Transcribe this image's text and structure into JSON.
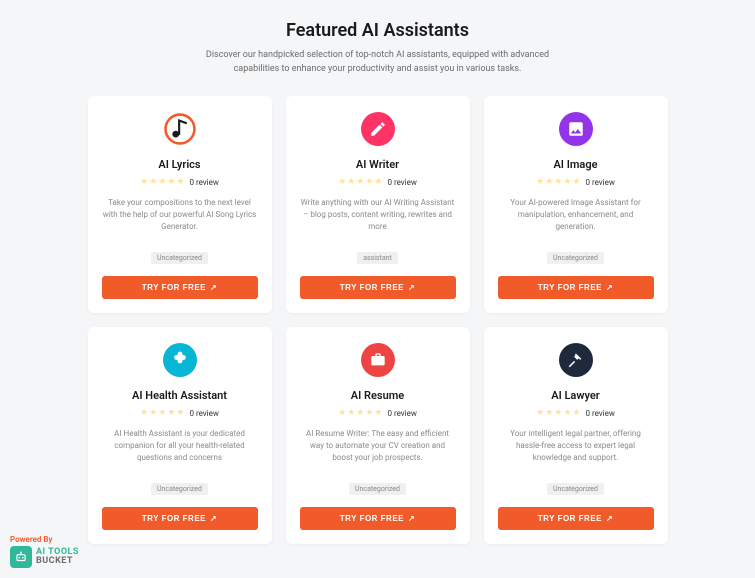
{
  "header": {
    "title": "Featured AI Assistants",
    "subtitle": "Discover our handpicked selection of top-notch AI assistants, equipped with advanced capabilities to enhance your productivity and assist you in various tasks."
  },
  "cta_label": "TRY FOR FREE",
  "review_suffix": "0 review",
  "cards": [
    {
      "title": "AI Lyrics",
      "desc": "Take your compositions to the next level with the help of our powerful AI Song Lyrics Generator.",
      "tag": "Uncategorized",
      "icon_bg": "#ffffff",
      "icon": "music-note"
    },
    {
      "title": "AI Writer",
      "desc": "Write anything with our AI Writing Assistant – blog posts, content writing, rewrites and more",
      "tag": "assistant",
      "icon_bg": "#ff3366",
      "icon": "pen"
    },
    {
      "title": "AI Image",
      "desc": "Your AI-powered Image Assistant for manipulation, enhancement, and generation.",
      "tag": "Uncategorized",
      "icon_bg": "#9333ea",
      "icon": "image"
    },
    {
      "title": "AI Health Assistant",
      "desc": "AI Health Assistant is your dedicated companion for all your health-related questions and concerns",
      "tag": "Uncategorized",
      "icon_bg": "#06b6d4",
      "icon": "medical"
    },
    {
      "title": "AI Resume",
      "desc": "AI Resume Writer: The easy and efficient way to automate your CV creation and boost your job prospects.",
      "tag": "Uncategorized",
      "icon_bg": "#ef4444",
      "icon": "briefcase"
    },
    {
      "title": "AI Lawyer",
      "desc": "Your intelligent legal partner, offering hassle-free access to expert legal knowledge and support.",
      "tag": "Uncategorized",
      "icon_bg": "#1e293b",
      "icon": "gavel"
    }
  ],
  "brand": {
    "powered": "Powered By",
    "line1": "AI TOOLS",
    "line2": "BUCKET"
  }
}
